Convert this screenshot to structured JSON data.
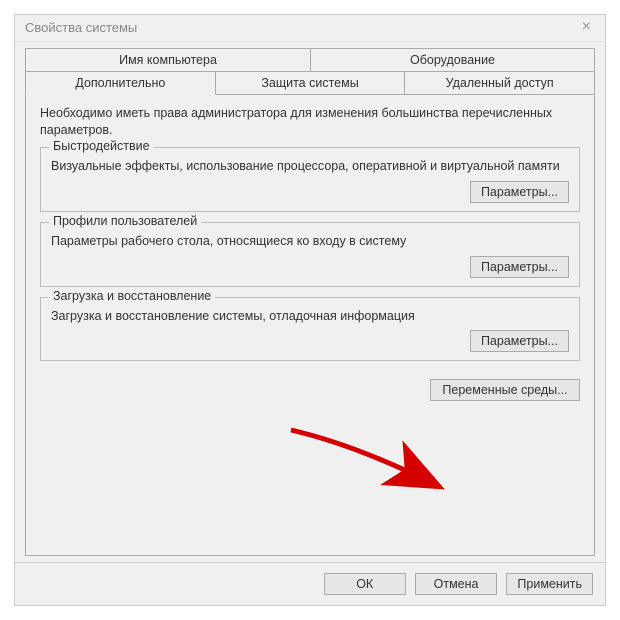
{
  "window": {
    "title": "Свойства системы",
    "close_label": "×"
  },
  "tabs": {
    "computer_name": "Имя компьютера",
    "hardware": "Оборудование",
    "advanced": "Дополнительно",
    "system_protection": "Защита системы",
    "remote": "Удаленный доступ"
  },
  "panel": {
    "intro": "Необходимо иметь права администратора для изменения большинства перечисленных параметров.",
    "performance": {
      "legend": "Быстродействие",
      "desc": "Визуальные эффекты, использование процессора, оперативной и виртуальной памяти",
      "button": "Параметры..."
    },
    "profiles": {
      "legend": "Профили пользователей",
      "desc": "Параметры рабочего стола, относящиеся ко входу в систему",
      "button": "Параметры..."
    },
    "startup": {
      "legend": "Загрузка и восстановление",
      "desc": "Загрузка и восстановление системы, отладочная информация",
      "button": "Параметры..."
    },
    "envvars_button": "Переменные среды..."
  },
  "footer": {
    "ok": "ОК",
    "cancel": "Отмена",
    "apply": "Применить"
  }
}
